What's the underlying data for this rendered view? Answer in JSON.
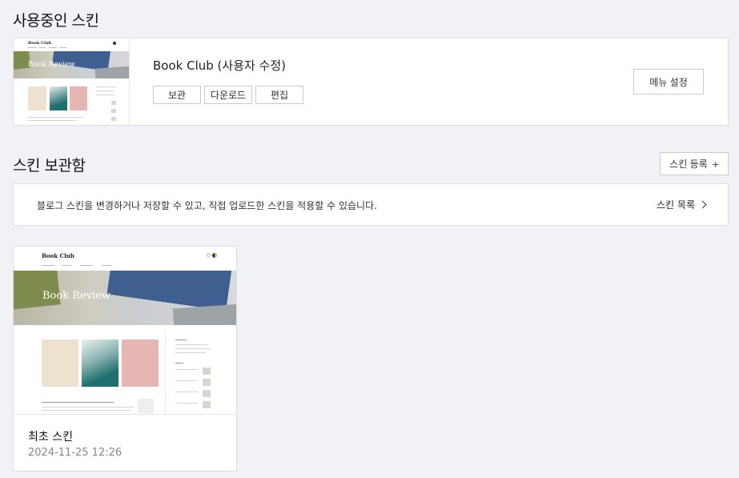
{
  "active_section": {
    "title": "사용중인 스킨",
    "skin_name": "Book Club (사용자 수정)",
    "buttons": [
      "보관",
      "다운로드",
      "편집"
    ],
    "menu_settings_label": "메뉴 설정",
    "thumb_logo": "Book Club",
    "thumb_hero": "Book Review"
  },
  "storage_section": {
    "title": "스킨 보관함",
    "register_label": "스킨 등록",
    "register_icon": "plus-icon",
    "info_text": "블로그 스킨을 변경하거나 저장할 수 있고, 직접 업로드한 스킨을 적용할 수 있습니다.",
    "list_link_label": "스킨 목록"
  },
  "saved_skins": [
    {
      "name": "최초 스킨",
      "date": "2024-11-25 12:26",
      "thumb_logo": "Book Club",
      "thumb_hero": "Book Review"
    }
  ],
  "colors": {
    "background": "#f1f2f5",
    "card_border": "#dcdde1",
    "book_blue": "#3e5f8f",
    "book_green": "#7e8c4e",
    "cover_teal": "#1f6f6e",
    "cover_pink": "#e6b7b2",
    "cover_cream": "#ece2cf"
  }
}
